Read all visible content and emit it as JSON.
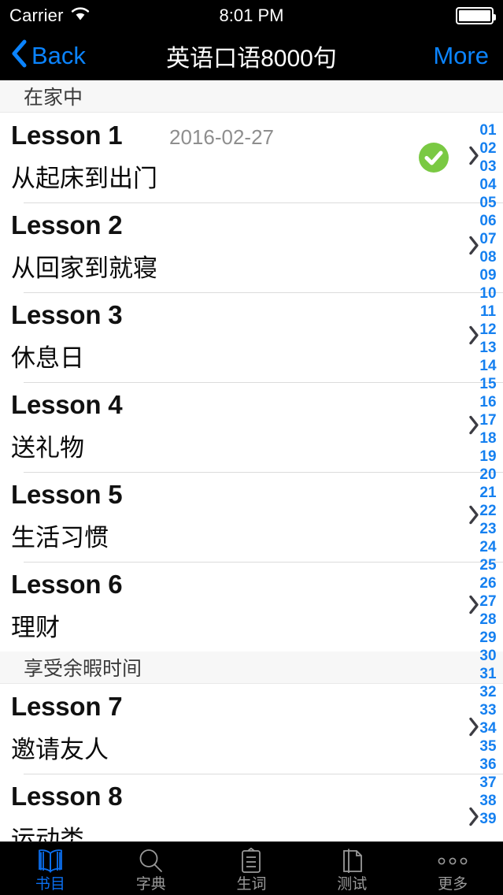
{
  "status_bar": {
    "carrier": "Carrier",
    "wifi_icon": "wifi-icon",
    "time": "8:01 PM",
    "battery_icon": "battery-full-icon"
  },
  "nav_bar": {
    "back_label": "Back",
    "back_icon": "chevron-left-icon",
    "title": "英语口语8000句",
    "more_label": "More"
  },
  "colors": {
    "accent_blue": "#0b84ff",
    "index_blue": "#1580f0",
    "check_green": "#7ac943",
    "section_header_bg": "#f7f7f7",
    "tab_active": "#0b6ff0",
    "tab_inactive": "#9a9a9a"
  },
  "list": {
    "sections": [
      {
        "header": "在家中",
        "lessons": [
          {
            "title": "Lesson 1",
            "date": "2016-02-27",
            "subtitle": "从起床到出门",
            "completed": true
          },
          {
            "title": "Lesson 2",
            "date": "",
            "subtitle": "从回家到就寝",
            "completed": false
          },
          {
            "title": "Lesson 3",
            "date": "",
            "subtitle": "休息日",
            "completed": false
          },
          {
            "title": "Lesson 4",
            "date": "",
            "subtitle": "送礼物",
            "completed": false
          },
          {
            "title": "Lesson 5",
            "date": "",
            "subtitle": "生活习惯",
            "completed": false
          },
          {
            "title": "Lesson 6",
            "date": "",
            "subtitle": "理财",
            "completed": false
          }
        ]
      },
      {
        "header": "享受余暇时间",
        "lessons": [
          {
            "title": "Lesson 7",
            "date": "",
            "subtitle": "邀请友人",
            "completed": false
          },
          {
            "title": "Lesson 8",
            "date": "",
            "subtitle": "运动类",
            "completed": false
          }
        ]
      }
    ]
  },
  "section_index": [
    "01",
    "02",
    "03",
    "04",
    "05",
    "06",
    "07",
    "08",
    "09",
    "10",
    "11",
    "12",
    "13",
    "14",
    "15",
    "16",
    "17",
    "18",
    "19",
    "20",
    "21",
    "22",
    "23",
    "24",
    "25",
    "26",
    "27",
    "28",
    "29",
    "30",
    "31",
    "32",
    "33",
    "34",
    "35",
    "36",
    "37",
    "38",
    "39"
  ],
  "tab_bar": {
    "items": [
      {
        "label": "书目",
        "icon": "open-book-icon",
        "active": true
      },
      {
        "label": "字典",
        "icon": "magnifier-icon",
        "active": false
      },
      {
        "label": "生词",
        "icon": "clipboard-icon",
        "active": false
      },
      {
        "label": "测试",
        "icon": "pen-paper-icon",
        "active": false
      },
      {
        "label": "更多",
        "icon": "ellipsis-icon",
        "active": false
      }
    ]
  }
}
